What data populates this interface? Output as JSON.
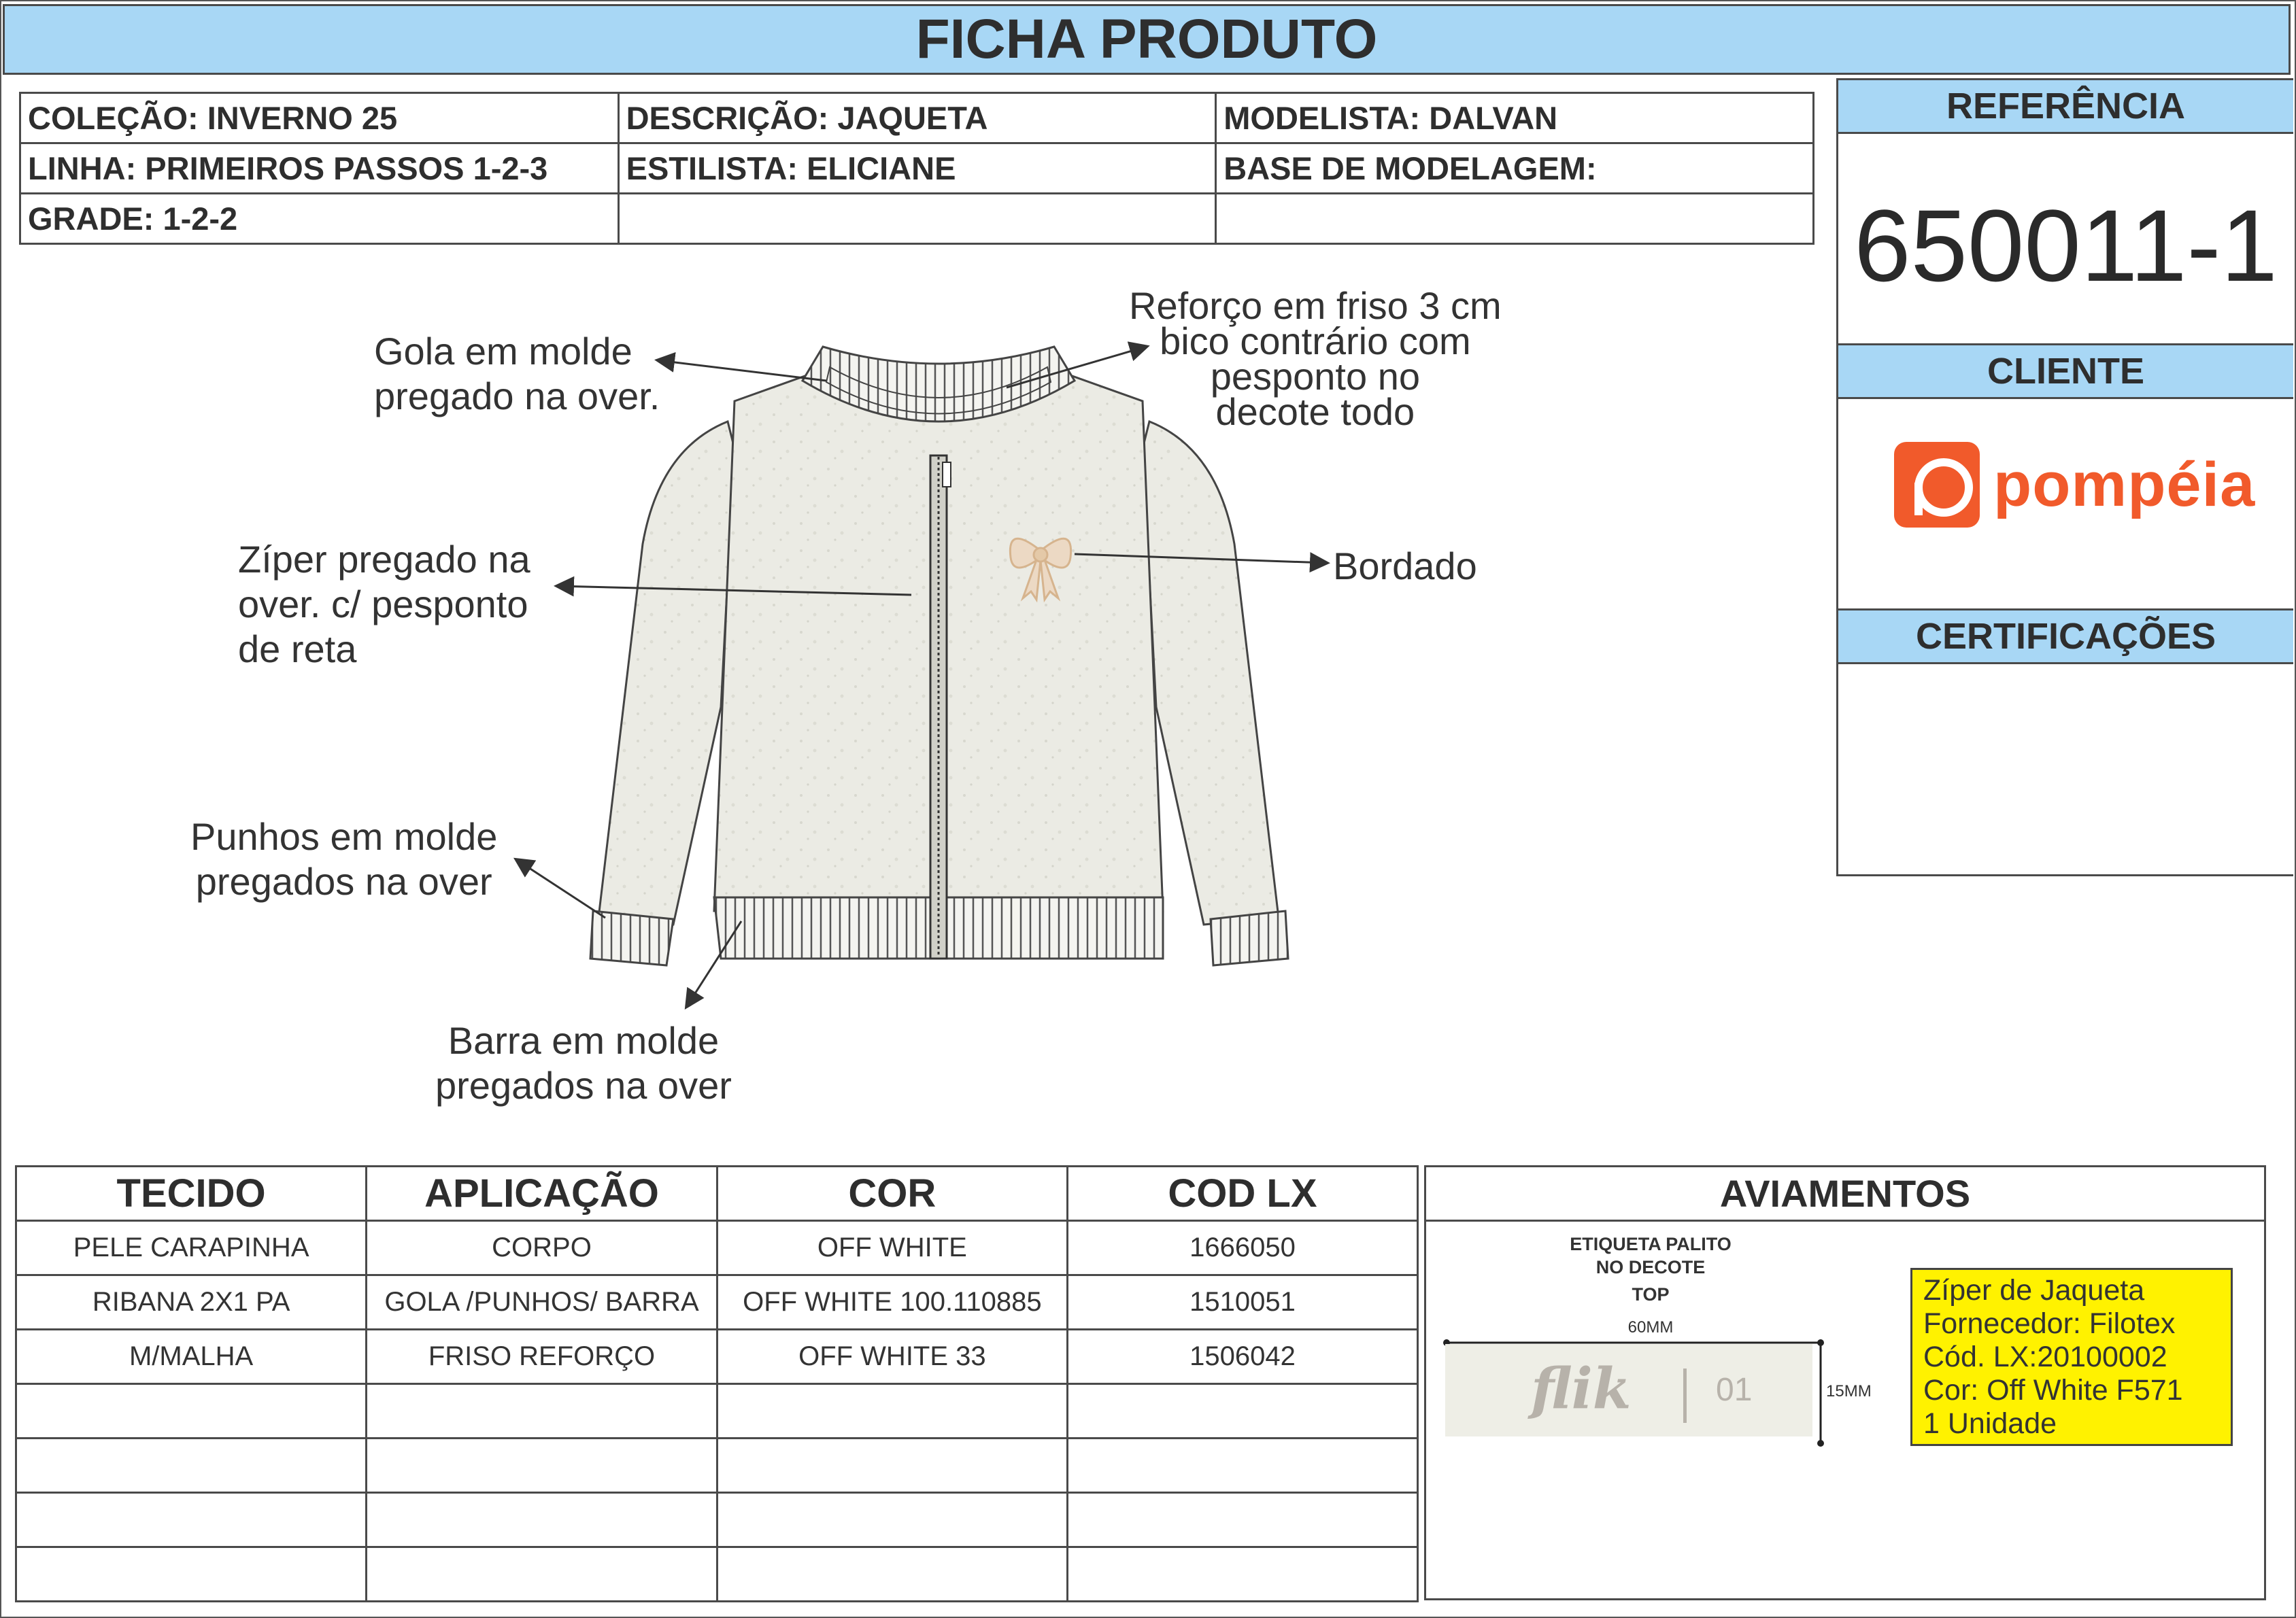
{
  "title": "FICHA PRODUTO",
  "info": {
    "colecao": "COLEÇÃO: INVERNO 25",
    "descricao": "DESCRIÇÃO: JAQUETA",
    "modelista": "MODELISTA: DALVAN",
    "linha": "LINHA: PRIMEIROS PASSOS 1-2-3",
    "estilista": "ESTILISTA: ELICIANE",
    "base": "BASE DE MODELAGEM:",
    "grade": "GRADE: 1-2-2"
  },
  "referencia": {
    "label": "REFERÊNCIA",
    "value": "650011-1"
  },
  "cliente": {
    "label": "CLIENTE",
    "logo_text": "pompéia",
    "logo_icon": "pompeia-logo-icon"
  },
  "certificacoes": {
    "label": "CERTIFICAÇÕES"
  },
  "callouts": {
    "gola": [
      "Gola em molde",
      "pregado na over."
    ],
    "reforco": [
      "Reforço em friso 3 cm",
      "bico contrário com",
      "pesponto no",
      "decote todo"
    ],
    "ziper": [
      "Zíper pregado na",
      "over. c/ pesponto",
      "de reta"
    ],
    "bordado": [
      "Bordado"
    ],
    "punhos": [
      "Punhos em molde",
      "pregados na over"
    ],
    "barra": [
      "Barra em molde",
      "pregados na over"
    ]
  },
  "fabric_table": {
    "headers": [
      "TECIDO",
      "APLICAÇÃO",
      "COR",
      "COD LX"
    ],
    "rows": [
      [
        "PELE CARAPINHA",
        "CORPO",
        "OFF WHITE",
        "1666050"
      ],
      [
        "RIBANA 2X1 PA",
        "GOLA /PUNHOS/ BARRA",
        "OFF WHITE 100.110885",
        "1510051"
      ],
      [
        "M/MALHA",
        "FRISO REFORÇO",
        "OFF WHITE 33",
        "1506042"
      ],
      [
        "",
        "",
        "",
        ""
      ],
      [
        "",
        "",
        "",
        ""
      ],
      [
        "",
        "",
        "",
        ""
      ],
      [
        "",
        "",
        "",
        ""
      ]
    ]
  },
  "aviamentos": {
    "label": "AVIAMENTOS",
    "etiqueta": [
      "ETIQUETA PALITO",
      "NO DECOTE"
    ],
    "top": "TOP",
    "width_label": "60MM",
    "height_label": "15MM",
    "label_brand": "flik",
    "label_num": "01",
    "note": [
      "Zíper de Jaqueta",
      "Fornecedor: Filotex",
      "Cód. LX:20100002",
      "Cor: Off White F571",
      "1 Unidade"
    ]
  },
  "colors": {
    "header_blue": "#a8d7f5",
    "note_yellow": "#fff200",
    "brand_orange": "#f15a2b"
  }
}
